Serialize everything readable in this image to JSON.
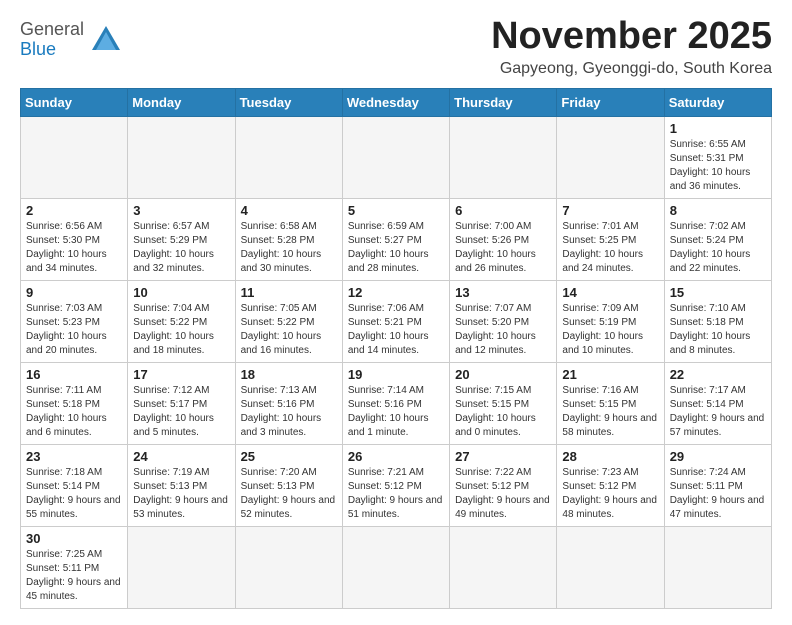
{
  "logo": {
    "general": "General",
    "blue": "Blue"
  },
  "title": "November 2025",
  "location": "Gapyeong, Gyeonggi-do, South Korea",
  "headers": [
    "Sunday",
    "Monday",
    "Tuesday",
    "Wednesday",
    "Thursday",
    "Friday",
    "Saturday"
  ],
  "weeks": [
    [
      {
        "day": "",
        "info": ""
      },
      {
        "day": "",
        "info": ""
      },
      {
        "day": "",
        "info": ""
      },
      {
        "day": "",
        "info": ""
      },
      {
        "day": "",
        "info": ""
      },
      {
        "day": "",
        "info": ""
      },
      {
        "day": "1",
        "info": "Sunrise: 6:55 AM\nSunset: 5:31 PM\nDaylight: 10 hours\nand 36 minutes."
      }
    ],
    [
      {
        "day": "2",
        "info": "Sunrise: 6:56 AM\nSunset: 5:30 PM\nDaylight: 10 hours\nand 34 minutes."
      },
      {
        "day": "3",
        "info": "Sunrise: 6:57 AM\nSunset: 5:29 PM\nDaylight: 10 hours\nand 32 minutes."
      },
      {
        "day": "4",
        "info": "Sunrise: 6:58 AM\nSunset: 5:28 PM\nDaylight: 10 hours\nand 30 minutes."
      },
      {
        "day": "5",
        "info": "Sunrise: 6:59 AM\nSunset: 5:27 PM\nDaylight: 10 hours\nand 28 minutes."
      },
      {
        "day": "6",
        "info": "Sunrise: 7:00 AM\nSunset: 5:26 PM\nDaylight: 10 hours\nand 26 minutes."
      },
      {
        "day": "7",
        "info": "Sunrise: 7:01 AM\nSunset: 5:25 PM\nDaylight: 10 hours\nand 24 minutes."
      },
      {
        "day": "8",
        "info": "Sunrise: 7:02 AM\nSunset: 5:24 PM\nDaylight: 10 hours\nand 22 minutes."
      }
    ],
    [
      {
        "day": "9",
        "info": "Sunrise: 7:03 AM\nSunset: 5:23 PM\nDaylight: 10 hours\nand 20 minutes."
      },
      {
        "day": "10",
        "info": "Sunrise: 7:04 AM\nSunset: 5:22 PM\nDaylight: 10 hours\nand 18 minutes."
      },
      {
        "day": "11",
        "info": "Sunrise: 7:05 AM\nSunset: 5:22 PM\nDaylight: 10 hours\nand 16 minutes."
      },
      {
        "day": "12",
        "info": "Sunrise: 7:06 AM\nSunset: 5:21 PM\nDaylight: 10 hours\nand 14 minutes."
      },
      {
        "day": "13",
        "info": "Sunrise: 7:07 AM\nSunset: 5:20 PM\nDaylight: 10 hours\nand 12 minutes."
      },
      {
        "day": "14",
        "info": "Sunrise: 7:09 AM\nSunset: 5:19 PM\nDaylight: 10 hours\nand 10 minutes."
      },
      {
        "day": "15",
        "info": "Sunrise: 7:10 AM\nSunset: 5:18 PM\nDaylight: 10 hours\nand 8 minutes."
      }
    ],
    [
      {
        "day": "16",
        "info": "Sunrise: 7:11 AM\nSunset: 5:18 PM\nDaylight: 10 hours\nand 6 minutes."
      },
      {
        "day": "17",
        "info": "Sunrise: 7:12 AM\nSunset: 5:17 PM\nDaylight: 10 hours\nand 5 minutes."
      },
      {
        "day": "18",
        "info": "Sunrise: 7:13 AM\nSunset: 5:16 PM\nDaylight: 10 hours\nand 3 minutes."
      },
      {
        "day": "19",
        "info": "Sunrise: 7:14 AM\nSunset: 5:16 PM\nDaylight: 10 hours\nand 1 minute."
      },
      {
        "day": "20",
        "info": "Sunrise: 7:15 AM\nSunset: 5:15 PM\nDaylight: 10 hours\nand 0 minutes."
      },
      {
        "day": "21",
        "info": "Sunrise: 7:16 AM\nSunset: 5:15 PM\nDaylight: 9 hours\nand 58 minutes."
      },
      {
        "day": "22",
        "info": "Sunrise: 7:17 AM\nSunset: 5:14 PM\nDaylight: 9 hours\nand 57 minutes."
      }
    ],
    [
      {
        "day": "23",
        "info": "Sunrise: 7:18 AM\nSunset: 5:14 PM\nDaylight: 9 hours\nand 55 minutes."
      },
      {
        "day": "24",
        "info": "Sunrise: 7:19 AM\nSunset: 5:13 PM\nDaylight: 9 hours\nand 53 minutes."
      },
      {
        "day": "25",
        "info": "Sunrise: 7:20 AM\nSunset: 5:13 PM\nDaylight: 9 hours\nand 52 minutes."
      },
      {
        "day": "26",
        "info": "Sunrise: 7:21 AM\nSunset: 5:12 PM\nDaylight: 9 hours\nand 51 minutes."
      },
      {
        "day": "27",
        "info": "Sunrise: 7:22 AM\nSunset: 5:12 PM\nDaylight: 9 hours\nand 49 minutes."
      },
      {
        "day": "28",
        "info": "Sunrise: 7:23 AM\nSunset: 5:12 PM\nDaylight: 9 hours\nand 48 minutes."
      },
      {
        "day": "29",
        "info": "Sunrise: 7:24 AM\nSunset: 5:11 PM\nDaylight: 9 hours\nand 47 minutes."
      }
    ],
    [
      {
        "day": "30",
        "info": "Sunrise: 7:25 AM\nSunset: 5:11 PM\nDaylight: 9 hours\nand 45 minutes."
      },
      {
        "day": "",
        "info": ""
      },
      {
        "day": "",
        "info": ""
      },
      {
        "day": "",
        "info": ""
      },
      {
        "day": "",
        "info": ""
      },
      {
        "day": "",
        "info": ""
      },
      {
        "day": "",
        "info": ""
      }
    ]
  ]
}
